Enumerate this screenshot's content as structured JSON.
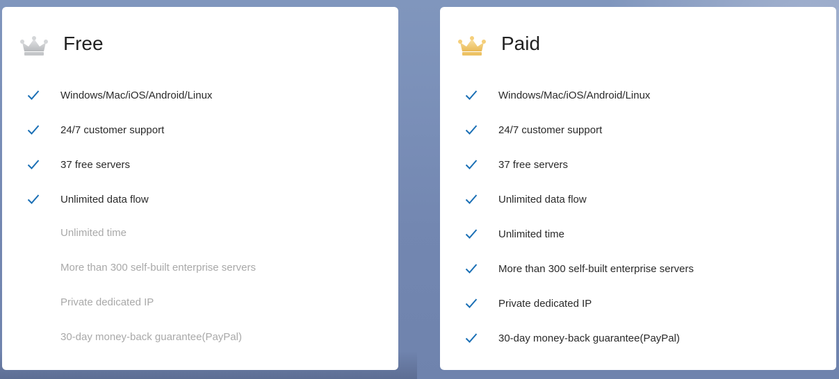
{
  "plans": [
    {
      "title": "Free",
      "crown_color": "#c8cacc",
      "features": [
        {
          "label": "Windows/Mac/iOS/Android/Linux",
          "included": true
        },
        {
          "label": "24/7 customer support",
          "included": true
        },
        {
          "label": "37 free servers",
          "included": true
        },
        {
          "label": "Unlimited data flow",
          "included": true
        },
        {
          "label": "Unlimited time",
          "included": false
        },
        {
          "label": "More than 300 self-built enterprise servers",
          "included": false
        },
        {
          "label": "Private dedicated IP",
          "included": false
        },
        {
          "label": "30-day money-back guarantee(PayPal)",
          "included": false
        }
      ]
    },
    {
      "title": "Paid",
      "crown_color": "#f0c872",
      "features": [
        {
          "label": "Windows/Mac/iOS/Android/Linux",
          "included": true
        },
        {
          "label": "24/7 customer support",
          "included": true
        },
        {
          "label": "37 free servers",
          "included": true
        },
        {
          "label": "Unlimited data flow",
          "included": true
        },
        {
          "label": "Unlimited time",
          "included": true
        },
        {
          "label": "More than 300 self-built enterprise servers",
          "included": true
        },
        {
          "label": "Private dedicated IP",
          "included": true
        },
        {
          "label": "30-day money-back guarantee(PayPal)",
          "included": true
        }
      ]
    }
  ],
  "colors": {
    "check": "#1a6fb5",
    "text": "#2a2a2a",
    "text_disabled": "#a9a9a9"
  },
  "icons": {
    "crown": "crown-icon",
    "check": "checkmark-icon"
  }
}
